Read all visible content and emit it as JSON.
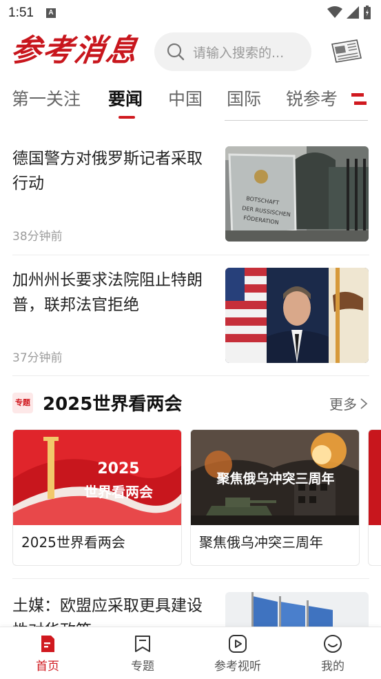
{
  "status_bar": {
    "time": "1:51",
    "notification_icon": "a-icon"
  },
  "header": {
    "logo_text": "参考消息",
    "search_placeholder": "请输入搜索的...",
    "newspaper_icon": "newspaper-icon"
  },
  "tabs": [
    {
      "label": "第一关注",
      "active": false
    },
    {
      "label": "要闻",
      "active": true
    },
    {
      "label": "中国",
      "active": false
    },
    {
      "label": "国际",
      "active": false
    },
    {
      "label": "锐参考",
      "active": false
    }
  ],
  "news": [
    {
      "title": "德国警方对俄罗斯记者采取行动",
      "time": "38分钟前",
      "image": "embassy-building-photo"
    },
    {
      "title": "加州州长要求法院阻止特朗普，联邦法官拒绝",
      "time": "37分钟前",
      "image": "governor-speaking-photo"
    }
  ],
  "topic_section": {
    "badge": "专题",
    "title": "2025世界看两会",
    "more_label": "更多",
    "cards": [
      {
        "label": "2025世界看两会",
        "overlay_year": "2025",
        "overlay_text": "世界看两会"
      },
      {
        "label": "聚焦俄乌冲突三周年",
        "overlay_text": "聚焦俄乌冲突三周年"
      }
    ]
  },
  "last_news": {
    "title": "土媒：欧盟应采取更具建设性对华政策"
  },
  "bottom_nav": [
    {
      "label": "首页",
      "icon": "home-doc-icon",
      "active": true
    },
    {
      "label": "专题",
      "icon": "bookmark-icon",
      "active": false
    },
    {
      "label": "参考视听",
      "icon": "play-icon",
      "active": false
    },
    {
      "label": "我的",
      "icon": "smile-icon",
      "active": false
    }
  ],
  "colors": {
    "accent": "#d0191f",
    "text": "#222222",
    "muted": "#9c9c9c"
  }
}
